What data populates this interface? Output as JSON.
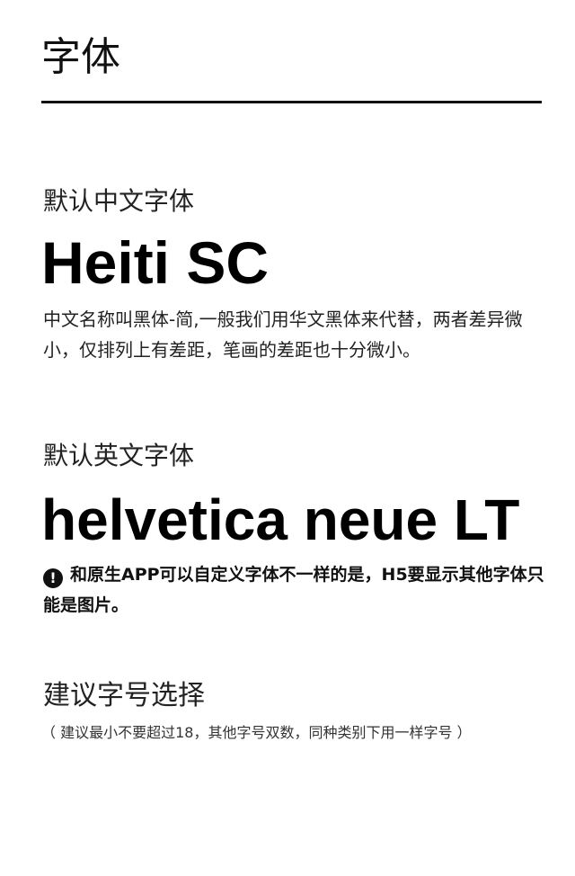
{
  "page": {
    "title": "字体"
  },
  "chinese_font": {
    "label": "默认中文字体",
    "sample": "Heiti SC",
    "description": "中文名称叫黑体-简,一般我们用华文黑体来代替，两者差异微小，仅排列上有差距，笔画的差距也十分微小。"
  },
  "english_font": {
    "label": "默认英文字体",
    "sample": "helvetica neue LT",
    "warning_icon": "exclamation-circle-icon",
    "warning_glyph": "!",
    "warning": "和原生APP可以自定义字体不一样的是，H5要显示其他字体只能是图片。"
  },
  "font_size": {
    "label": "建议字号选择",
    "note": "（ 建议最小不要超过18，其他字号双数，同种类别下用一样字号 ）"
  }
}
